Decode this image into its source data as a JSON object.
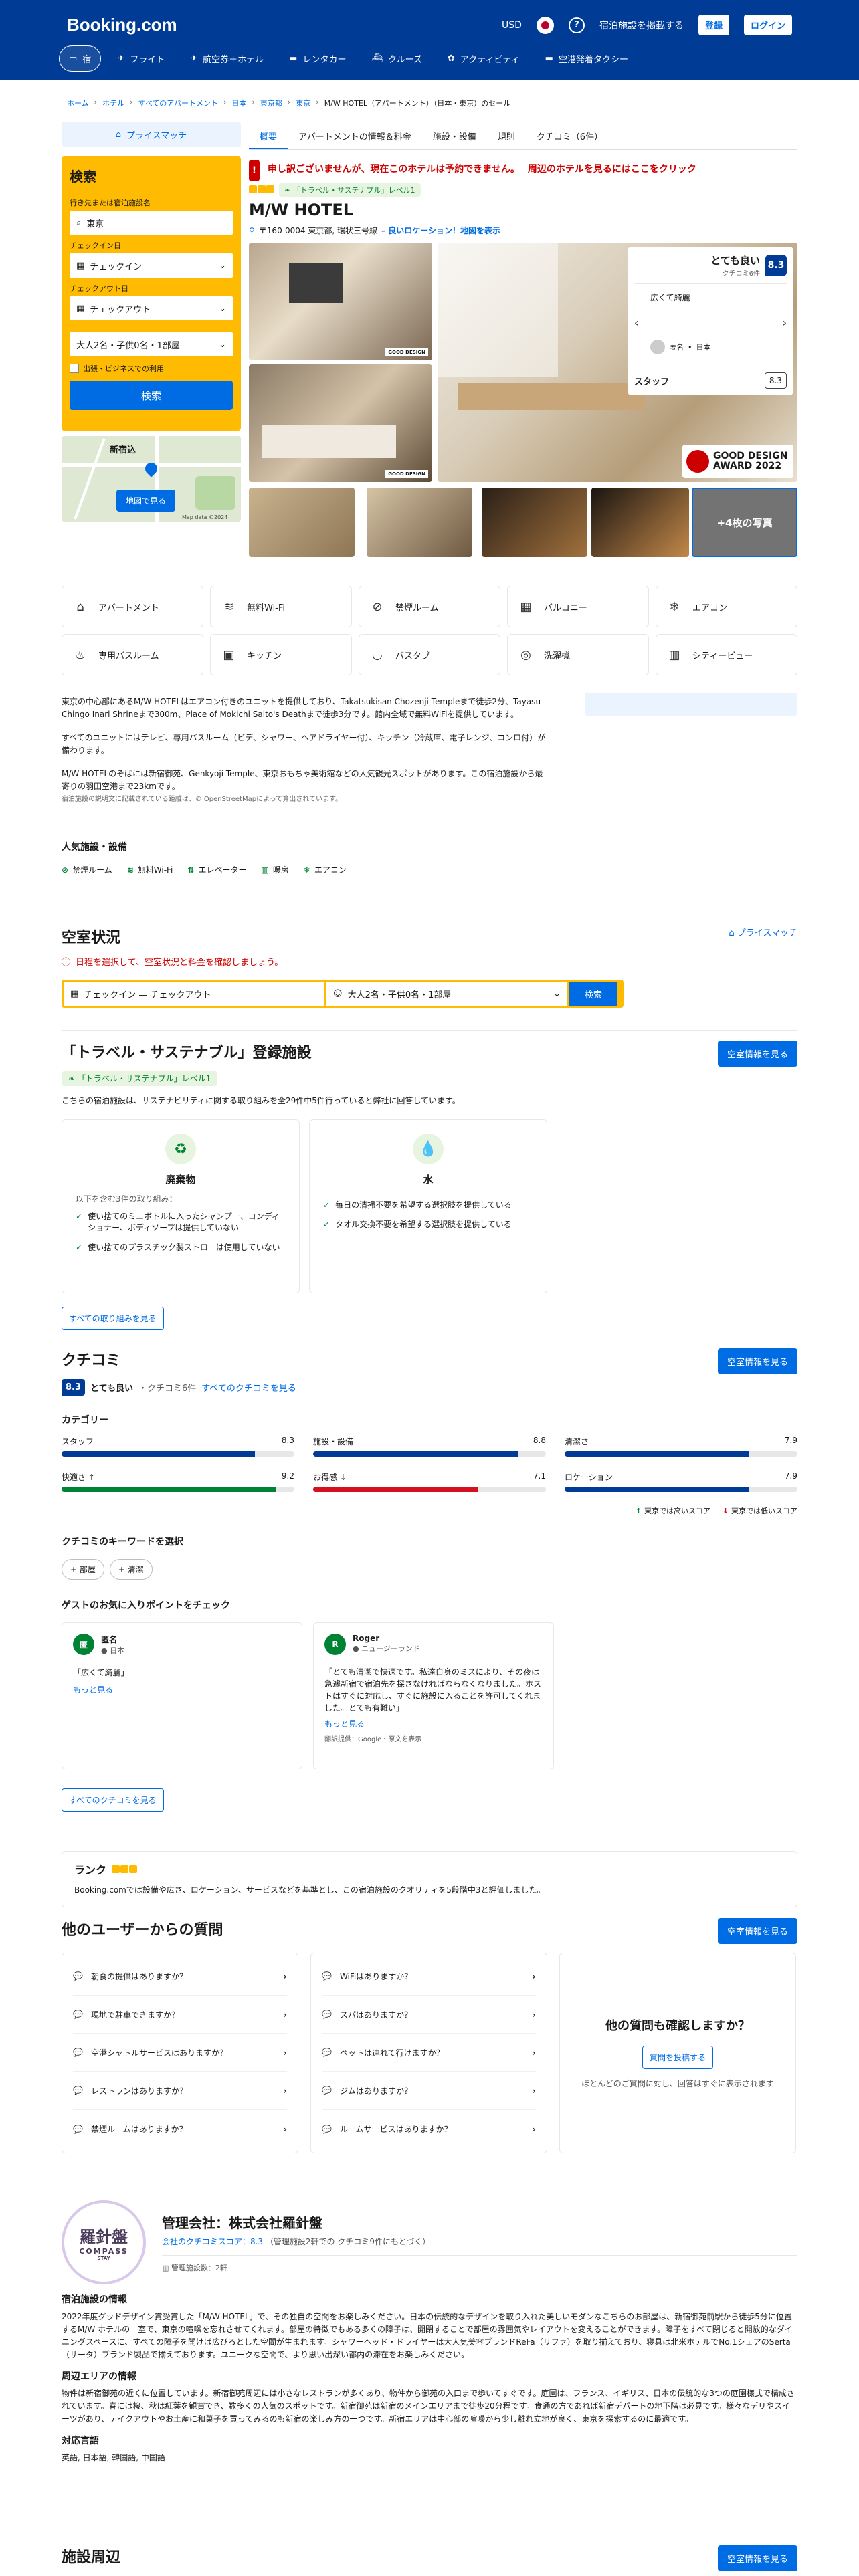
{
  "header": {
    "logo": "Booking.com",
    "currency": "USD",
    "list_property": "宿泊施設を掲載する",
    "register": "登録",
    "login": "ログイン"
  },
  "nav": [
    {
      "label": "宿",
      "icon": "bed-icon"
    },
    {
      "label": "フライト",
      "icon": "plane-icon"
    },
    {
      "label": "航空券＋ホテル",
      "icon": "plane-hotel-icon"
    },
    {
      "label": "レンタカー",
      "icon": "car-icon"
    },
    {
      "label": "クルーズ",
      "icon": "ship-icon"
    },
    {
      "label": "アクティビティ",
      "icon": "attraction-icon"
    },
    {
      "label": "空港発着タクシー",
      "icon": "taxi-icon"
    }
  ],
  "breadcrumb": [
    "ホーム",
    "ホテル",
    "すべてのアパートメント",
    "日本",
    "東京都",
    "東京",
    "M/W HOTEL（アパートメント）（日本・東京）のセール"
  ],
  "sidebar": {
    "price_match": "プライスマッチ",
    "search_title": "検索",
    "dest_label": "行き先または宿泊施設名",
    "dest_value": "東京",
    "checkin_label": "チェックイン日",
    "checkin_value": "チェックイン",
    "checkout_label": "チェックアウト日",
    "checkout_value": "チェックアウト",
    "guests": "大人2名・子供0名・1部屋",
    "business": "出張・ビジネスでの利用",
    "search_btn": "検索",
    "map_label": "新宿込",
    "map_btn": "地図で見る",
    "map_credit": "Map data ©2024"
  },
  "tabs": [
    "概要",
    "アパートメントの情報＆料金",
    "施設・設備",
    "規則",
    "クチコミ（6件）"
  ],
  "alert": {
    "text": "申し訳ございませんが、現在このホテルは予約できません。",
    "link": "周辺のホテルを見るにはここをクリック"
  },
  "property": {
    "sustain": "「トラベル・サステナブル」レベル1",
    "name": "M/W HOTEL",
    "address": "〒160-0004 東京都, 環状三号線",
    "address_link": "– 良いロケーション！地図を表示"
  },
  "review_box": {
    "rating_text": "とても良い",
    "count": "クチコミ6件",
    "score": "8.3",
    "quote": "広くて綺麗",
    "reviewer": "匿名",
    "country": "日本",
    "staff_label": "スタッフ",
    "staff_score": "8.3"
  },
  "gallery": {
    "badge": "GOOD DESIGN",
    "award_line1": "GOOD DESIGN",
    "award_line2": "AWARD 2022",
    "more": "+4枚の写真"
  },
  "facilities": [
    {
      "label": "アパートメント",
      "icon": "apartment-icon",
      "glyph": "⌂"
    },
    {
      "label": "無料Wi-Fi",
      "icon": "wifi-icon",
      "glyph": "≋"
    },
    {
      "label": "禁煙ルーム",
      "icon": "no-smoking-icon",
      "glyph": "⊘"
    },
    {
      "label": "バルコニー",
      "icon": "balcony-icon",
      "glyph": "▦"
    },
    {
      "label": "エアコン",
      "icon": "snowflake-icon",
      "glyph": "❄"
    },
    {
      "label": "専用バスルーム",
      "icon": "bath-icon",
      "glyph": "♨"
    },
    {
      "label": "キッチン",
      "icon": "kitchen-icon",
      "glyph": "▣"
    },
    {
      "label": "バスタブ",
      "icon": "bathtub-icon",
      "glyph": "◡"
    },
    {
      "label": "洗濯機",
      "icon": "washer-icon",
      "glyph": "◎"
    },
    {
      "label": "シティービュー",
      "icon": "city-icon",
      "glyph": "▥"
    }
  ],
  "description": {
    "p1": "東京の中心部にあるM/W HOTELはエアコン付きのユニットを提供しており、Takatsukisan Chozenji Templeまで徒歩2分、Tayasu Chingo Inari Shrineまで300m、Place of Mokichi Saito's Deathまで徒歩3分です。館内全域で無料WiFiを提供しています。",
    "p2": "すべてのユニットにはテレビ、専用バスルーム（ビデ、シャワー、ヘアドライヤー付）、キッチン（冷蔵庫、電子レンジ、コンロ付）が備わります。",
    "p3": "M/W HOTELのそばには新宿御苑、Genkyoji Temple、東京おもちゃ美術館などの人気観光スポットがあります。この宿泊施設から最寄りの羽田空港まで23kmです。",
    "p4": "宿泊施設の説明文に記載されている距離は、© OpenStreetMapによって算出されています。"
  },
  "popular": {
    "title": "人気施設・設備",
    "items": [
      "禁煙ルーム",
      "無料Wi-Fi",
      "エレベーター",
      "暖房",
      "エアコン"
    ]
  },
  "availability": {
    "title": "空室状況",
    "price_match": "プライスマッチ",
    "error": "日程を選択して、空室状況と料金を確認しましょう。",
    "dates": "チェックイン — チェックアウト",
    "guests": "大人2名・子供0名・1部屋",
    "search": "検索"
  },
  "sustain_sec": {
    "title": "「トラベル・サステナブル」登録施設",
    "btn": "空室情報を見る",
    "badge": "「トラベル・サステナブル」レベル1",
    "intro": "こちらの宿泊施設は、サステナビリティに関する取り組みを全29件中5件行っていると弊社に回答しています。",
    "waste_title": "廃棄物",
    "waste_sub": "以下を含む3件の取り組み：",
    "waste": [
      "使い捨てのミニボトルに入ったシャンプー、コンディショナー、ボディソープは提供していない",
      "使い捨てのプラスチック製ストローは使用していない"
    ],
    "water_title": "水",
    "water": [
      "毎日の清掃不要を希望する選択肢を提供している",
      "タオル交換不要を希望する選択肢を提供している"
    ],
    "all_btn": "すべての取り組みを見る"
  },
  "reviews": {
    "title": "クチコミ",
    "btn": "空室情報を見る",
    "score": "8.3",
    "rating": "とても良い",
    "count": "・クチコミ6件",
    "all_link": "すべてのクチコミを見る",
    "cat_title": "カテゴリー",
    "high": "東京では高いスコア",
    "low": "東京では低いスコア",
    "kw_title": "クチコミのキーワードを選択",
    "kw": [
      "+ 部屋",
      "+ 清潔"
    ],
    "fav_title": "ゲストのお気に入りポイントをチェック",
    "all_btn": "すべてのクチコミを見る"
  },
  "categories": [
    {
      "name": "スタッフ",
      "score": 8.3,
      "color": "#003b95"
    },
    {
      "name": "施設・設備",
      "score": 8.8,
      "color": "#003b95"
    },
    {
      "name": "清潔さ",
      "score": 7.9,
      "color": "#003b95"
    },
    {
      "name": "快適さ ↑",
      "score": 9.2,
      "color": "#008234"
    },
    {
      "name": "お得感 ↓",
      "score": 7.1,
      "color": "#d4111e"
    },
    {
      "name": "ロケーション",
      "score": 7.9,
      "color": "#003b95"
    }
  ],
  "guests": [
    {
      "initial": "匿",
      "name": "匿名",
      "country": "日本",
      "text": "「広くて綺麗」",
      "more": "もっと見る",
      "color": "#008234"
    },
    {
      "initial": "R",
      "name": "Roger",
      "country": "ニュージーランド",
      "text": "「とても清潔で快適です。私達自身のミスにより、その夜は急遽新宿で宿泊先を探さなければならなくなりました。ホストはすぐに対応し、すぐに施設に入ることを許可してくれました。とても有難い」",
      "more": "もっと見る",
      "translate": "翻訳提供：Google・原文を表示",
      "color": "#008234"
    }
  ],
  "rank": {
    "title": "ランク",
    "text": "Booking.comでは設備や広さ、ロケーション、サービスなどを基準とし、この宿泊施設のクオリティを5段階中3と評価しました。"
  },
  "qa": {
    "title": "他のユーザーからの質問",
    "btn": "空室情報を見る",
    "left": [
      "朝食の提供はありますか？",
      "現地で駐車できますか？",
      "空港シャトルサービスはありますか？",
      "レストランはありますか？",
      "禁煙ルームはありますか？"
    ],
    "right": [
      "WiFiはありますか？",
      "スパはありますか？",
      "ペットは連れて行けますか？",
      "ジムはありますか？",
      "ルームサービスはありますか？"
    ],
    "box_title": "他の質問も確認しますか？",
    "box_btn": "質問を投稿する",
    "box_text": "ほとんどのご質問に対し、回答はすぐに表示されます"
  },
  "host": {
    "logo_main": "羅針盤",
    "logo_sub": "COMPASS",
    "logo_stay": "STAY",
    "name": "管理会社：株式会社羅針盤",
    "score": "会社のクチコミスコア：8.3",
    "score_note": "（管理施設2軒での クチコミ9件にもとづく）",
    "count": "管理施設数：2軒",
    "info_title": "宿泊施設の情報",
    "info": "2022年度グッドデザイン賞受賞した「M/W HOTEL」で、その独自の空間をお楽しみください。日本の伝統的なデザインを取り入れた美しいモダンなこちらのお部屋は、新宿御苑前駅から徒歩5分に位置するM/W ホテルの一室で、東京の喧噪を忘れさせてくれます。部屋の特徴でもある多くの障子は、開閉することで部屋の雰囲気やレイアウトを変えることができます。障子をすべて閉じると開放的なダイニングスペースに、すべての障子を開けば広びろとした空間が生まれます。シャワーヘッド・ドライヤーは大人気美容ブランドReFa（リファ）を取り揃えており、寝具は北米ホテルでNo.1シェアのSerta（サータ）ブランド製品で揃えております。ユニークな空間で、より思い出深い都内の滞在をお楽しみください。",
    "area_title": "周辺エリアの情報",
    "area": "物件は新宿御苑の近くに位置しています。新宿御苑周辺には小さなレストランが多くあり、物件から御苑の入口まで歩いてすぐです。庭園は、フランス、イギリス、日本の伝統的な3つの庭園様式で構成されています。春には桜、秋は紅葉を観賞でき、数多くの人気のスポットです。新宿御苑は新宿のメインエリアまで徒歩20分程です。食通の方であれば新宿デパートの地下階は必見です。様々なデリやスイーツがあり、テイクアウトやお土産に和菓子を買ってみるのも新宿の楽しみ方の一つです。新宿エリアは中心部の喧噪から少し離れ立地が良く、東京を探索するのに最適です。",
    "lang_title": "対応言語",
    "lang": "英語, 日本語, 韓国語, 中国語"
  },
  "nearby": {
    "title": "施設周辺",
    "btn": "空室情報を見る"
  }
}
